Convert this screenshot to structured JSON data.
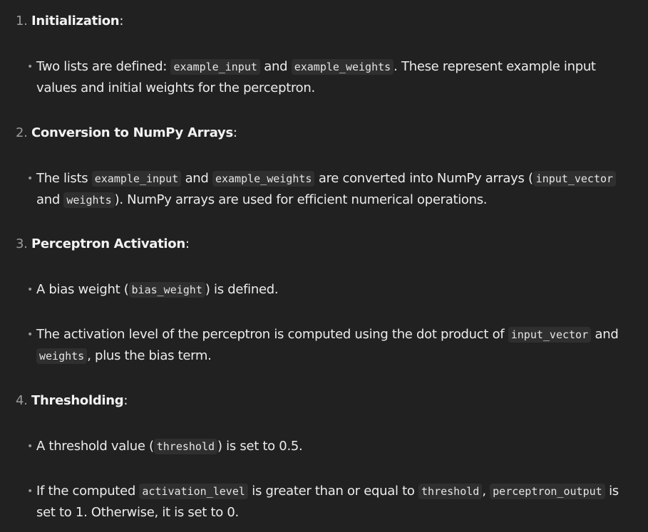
{
  "sections": [
    {
      "number": "1.",
      "title": "Initialization",
      "bullets": [
        {
          "parts": [
            {
              "t": "Two lists are defined: "
            },
            {
              "c": "example_input"
            },
            {
              "t": " and "
            },
            {
              "c": "example_weights"
            },
            {
              "t": ". These represent example input values and initial weights for the perceptron."
            }
          ]
        }
      ]
    },
    {
      "number": "2.",
      "title": "Conversion to NumPy Arrays",
      "bullets": [
        {
          "parts": [
            {
              "t": "The lists "
            },
            {
              "c": "example_input"
            },
            {
              "t": " and "
            },
            {
              "c": "example_weights"
            },
            {
              "t": " are converted into NumPy arrays ("
            },
            {
              "c": "input_vector"
            },
            {
              "t": " and "
            },
            {
              "c": "weights"
            },
            {
              "t": "). NumPy arrays are used for efficient numerical operations."
            }
          ]
        }
      ]
    },
    {
      "number": "3.",
      "title": "Perceptron Activation",
      "bullets": [
        {
          "parts": [
            {
              "t": "A bias weight ("
            },
            {
              "c": "bias_weight"
            },
            {
              "t": ") is defined."
            }
          ]
        },
        {
          "parts": [
            {
              "t": "The activation level of the perceptron is computed using the dot product of "
            },
            {
              "c": "input_vector"
            },
            {
              "t": " and "
            },
            {
              "c": "weights"
            },
            {
              "t": ", plus the bias term."
            }
          ]
        }
      ]
    },
    {
      "number": "4.",
      "title": "Thresholding",
      "bullets": [
        {
          "parts": [
            {
              "t": "A threshold value ("
            },
            {
              "c": "threshold"
            },
            {
              "t": ") is set to 0.5."
            }
          ]
        },
        {
          "parts": [
            {
              "t": "If the computed "
            },
            {
              "c": "activation_level"
            },
            {
              "t": " is greater than or equal to "
            },
            {
              "c": "threshold"
            },
            {
              "t": ", "
            },
            {
              "c": "perceptron_output"
            },
            {
              "t": " is set to 1. Otherwise, it is set to 0."
            }
          ]
        }
      ]
    }
  ]
}
